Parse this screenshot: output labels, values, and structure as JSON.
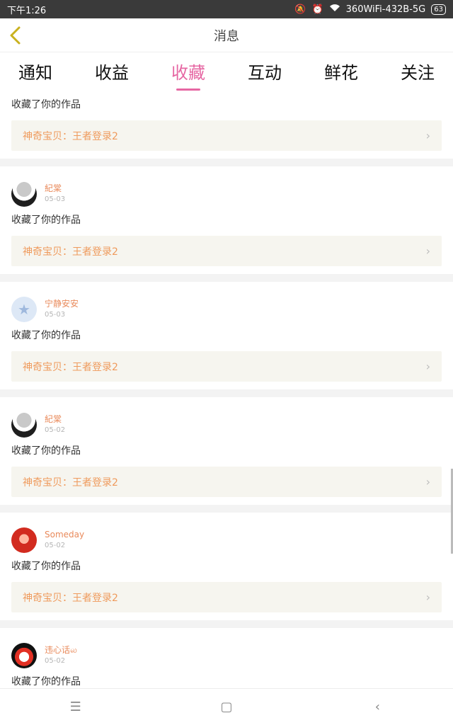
{
  "status_bar": {
    "time": "下午1:26",
    "icons": [
      "mute-bell-icon",
      "alarm-icon",
      "wifi-icon"
    ],
    "network": "360WiFi-432B-5G",
    "battery": "63"
  },
  "header": {
    "title": "消息",
    "back_icon": "chevron-left-icon"
  },
  "tabs": [
    "通知",
    "收益",
    "收藏",
    "互动",
    "鲜花",
    "关注"
  ],
  "active_tab_index": 2,
  "colors": {
    "accent": "#e667a3",
    "name": "#e98a5b",
    "work": "#ef9a5c",
    "back": "#c9b11e"
  },
  "items": [
    {
      "action": "收藏了你的作品",
      "work": "神奇宝贝：王者登录2"
    },
    {
      "user": "紀棠",
      "date": "05-03",
      "avatar": "anime-boy-avatar",
      "action": "收藏了你的作品",
      "work": "神奇宝贝：王者登录2"
    },
    {
      "user": "宁静安安",
      "date": "05-03",
      "avatar": "default-star-avatar",
      "action": "收藏了你的作品",
      "work": "神奇宝贝：王者登录2"
    },
    {
      "user": "紀棠",
      "date": "05-02",
      "avatar": "anime-boy-avatar",
      "action": "收藏了你的作品",
      "work": "神奇宝贝：王者登录2"
    },
    {
      "user": "Someday",
      "date": "05-02",
      "avatar": "red-hair-avatar",
      "action": "收藏了你的作品",
      "work": "神奇宝贝：王者登录2"
    },
    {
      "user": "违心话ல",
      "date": "05-02",
      "avatar": "clown-avatar",
      "action": "收藏了你的作品",
      "work": ""
    }
  ],
  "nav": {
    "menu": "☰",
    "home": "▢",
    "back": "‹"
  }
}
